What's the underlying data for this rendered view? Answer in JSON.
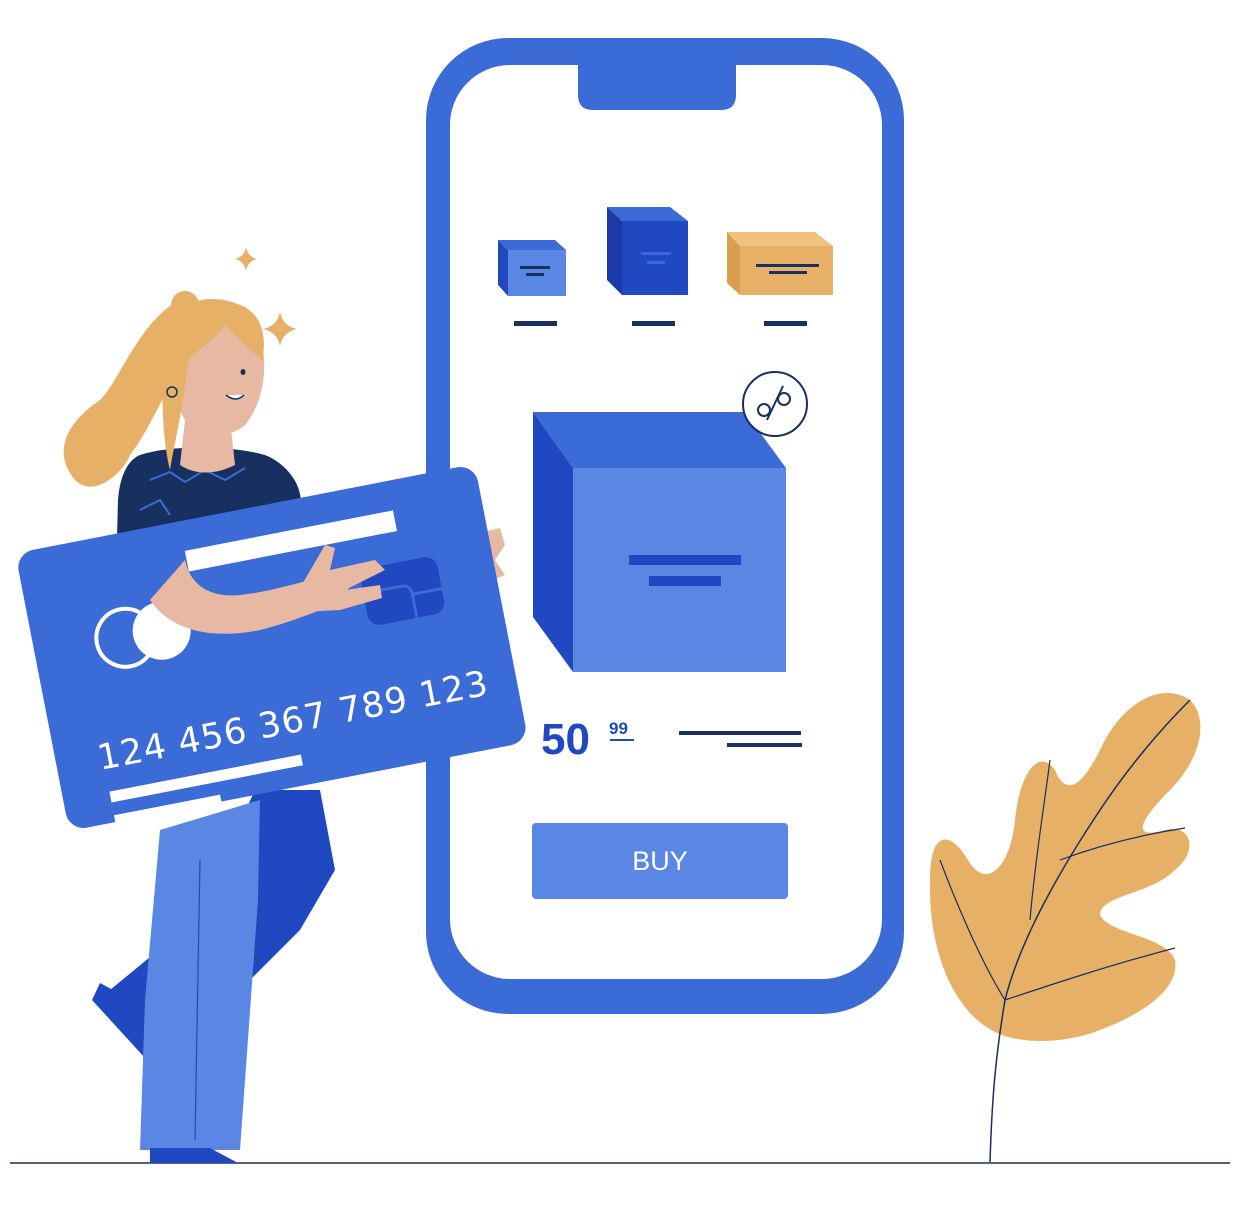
{
  "colors": {
    "phone_frame": "#3a6bd6",
    "phone_screen": "#ffffff",
    "accent_blue": "#1f48c1",
    "light_blue": "#5a87e4",
    "navy": "#17305f",
    "gold": "#e6b066",
    "skin": "#e8b9a2"
  },
  "product": {
    "price_main": "50",
    "price_cents": "99",
    "discount_icon": "percent-icon",
    "buy_label": "BUY"
  },
  "card": {
    "number": "124 456 367 789 123"
  },
  "icons": [
    "sparkle-icon",
    "percent-icon",
    "leaf-icon",
    "card-chip-icon",
    "card-logo-icon"
  ]
}
